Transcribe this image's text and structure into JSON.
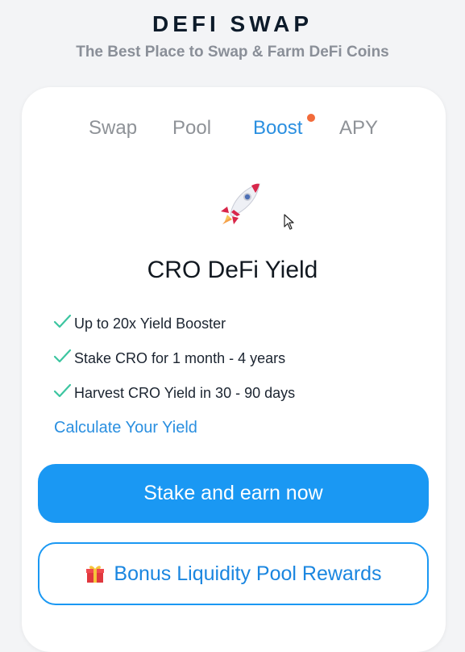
{
  "header": {
    "title": "DEFI SWAP",
    "subtitle": "The Best Place to Swap & Farm DeFi Coins"
  },
  "tabs": [
    {
      "label": "Swap",
      "active": false
    },
    {
      "label": "Pool",
      "active": false
    },
    {
      "label": "Boost",
      "active": true,
      "notification": true
    },
    {
      "label": "APY",
      "active": false
    }
  ],
  "card": {
    "icon": "rocket-icon",
    "title": "CRO DeFi Yield",
    "features": [
      "Up to 20x Yield Booster",
      "Stake CRO for 1 month - 4 years",
      "Harvest CRO Yield in 30 - 90 days"
    ],
    "calculate_link": "Calculate Your Yield",
    "primary_button": "Stake and earn now",
    "secondary_button": "Bonus Liquidity Pool Rewards",
    "secondary_icon": "gift-icon"
  },
  "colors": {
    "accent": "#1a98f3",
    "check": "#3cc5a0",
    "notification": "#f26b3a",
    "title_text": "#0d1b2a",
    "subtitle_text": "#8a8f98"
  }
}
